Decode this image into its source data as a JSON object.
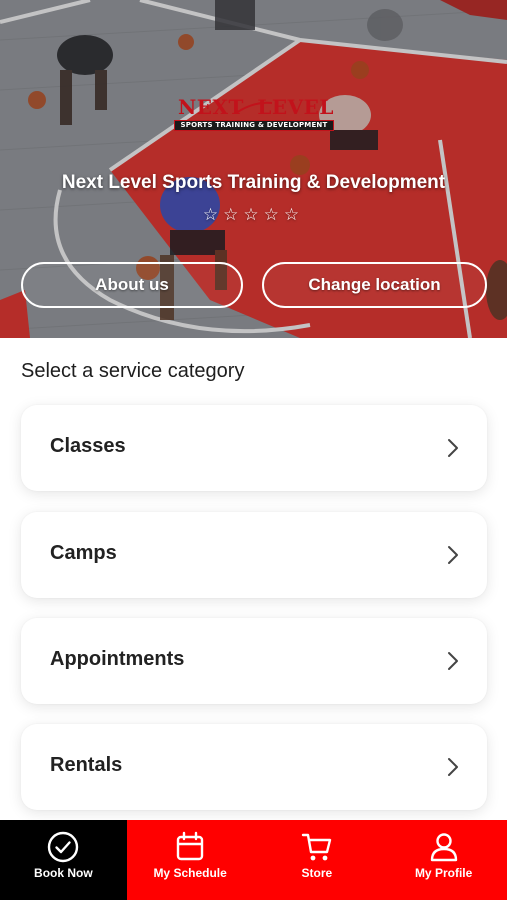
{
  "hero": {
    "logo": {
      "word_left": "NEXT",
      "word_right": "LEVEL",
      "tagline": "SPORTS TRAINING & DEVELOPMENT"
    },
    "business_name": "Next Level Sports Training & Development",
    "rating": {
      "stars_text": "☆☆☆☆☆",
      "value": 0,
      "max": 5
    },
    "about_label": "About us",
    "change_location_label": "Change location"
  },
  "services": {
    "title": "Select a service category",
    "categories": [
      {
        "label": "Classes"
      },
      {
        "label": "Camps"
      },
      {
        "label": "Appointments"
      },
      {
        "label": "Rentals"
      }
    ]
  },
  "bottom_nav": {
    "items": [
      {
        "label": "Book Now",
        "icon": "check-circle-icon",
        "active": true
      },
      {
        "label": "My Schedule",
        "icon": "calendar-icon",
        "active": false
      },
      {
        "label": "Store",
        "icon": "cart-icon",
        "active": false
      },
      {
        "label": "My Profile",
        "icon": "user-icon",
        "active": false
      }
    ]
  },
  "colors": {
    "brand_red": "#ff0000",
    "logo_red": "#c2121b",
    "nav_active_bg": "#000000",
    "court_red": "#d8322d",
    "court_gray": "#8f9296"
  }
}
